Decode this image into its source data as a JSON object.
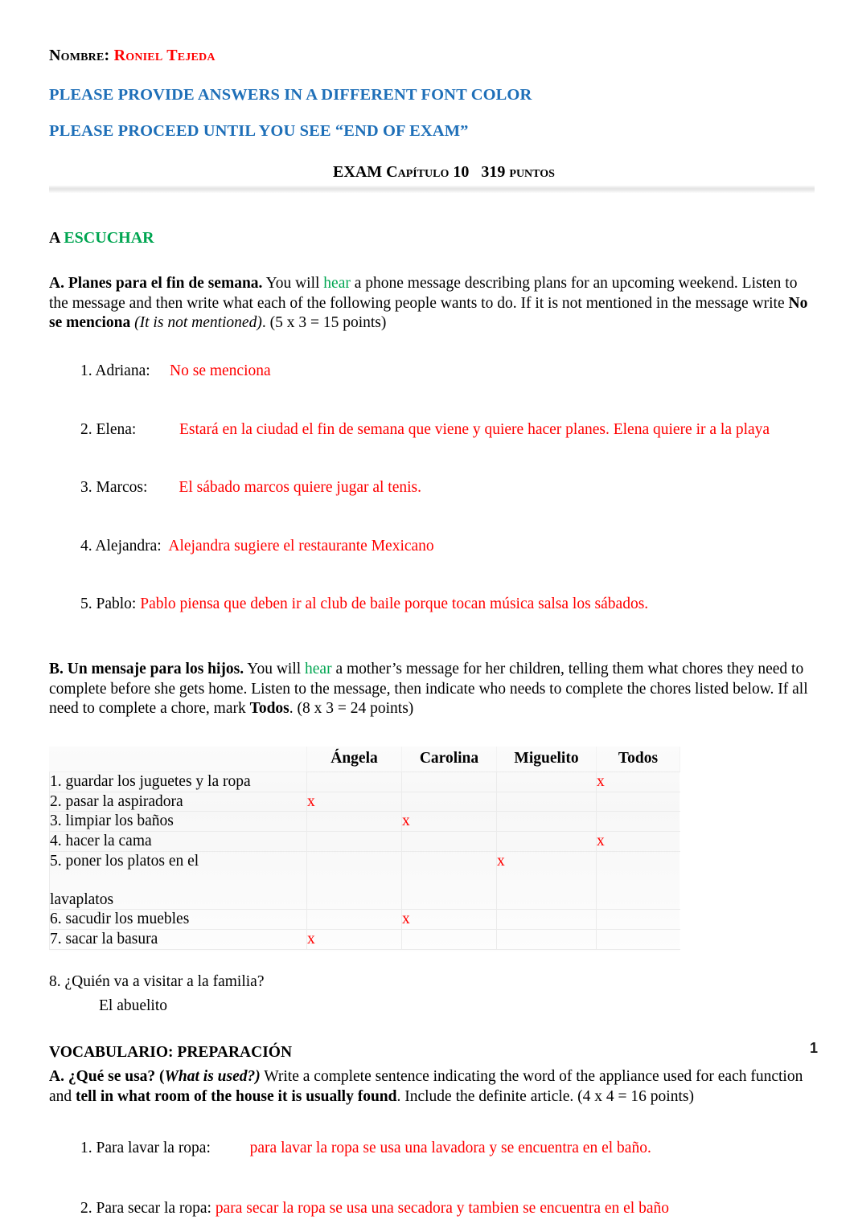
{
  "header": {
    "nombre_label": "Nombre:",
    "student_name": "Roniel Tejeda",
    "notice_1": "PLEASE PROVIDE ANSWERS IN A DIFFERENT FONT COLOR",
    "notice_2": "PLEASE PROCEED UNTIL YOU SEE “END OF EXAM”",
    "exam_title_main": "EXAM ",
    "exam_title_chapter": "Capítulo 10",
    "exam_title_points": "319 puntos"
  },
  "colors": {
    "answer_red": "#FF0000",
    "notice_blue": "#1E6FB8",
    "accent_green": "#00A551",
    "text_black": "#000000",
    "divider_gray": "#E8E8E8",
    "table_border": "#EBEBEB"
  },
  "section_a": {
    "letter": "A ",
    "heading": "ESCUCHAR",
    "activity_a": {
      "title": "A. Planes para el fin de semana.",
      "text_1": "  You will ",
      "link_word": "hear",
      "text_2": " a phone message describing plans for an upcoming weekend. Listen to the message and then write what each of the following people wants to do. If it is not mentioned in the message write ",
      "bold_phrase": "No se menciona",
      "italic_phrase": " (It is not mentioned)",
      "text_3": ".  (5 x 3 = 15 points)",
      "answers": [
        {
          "label": "1. Adriana:",
          "pad": "     ",
          "value": "No se menciona"
        },
        {
          "label": "2. Elena:",
          "pad": "           ",
          "value": "Estará en la ciudad el fin de semana que viene y quiere hacer planes. Elena quiere ir a la playa"
        },
        {
          "label": "3. Marcos:",
          "pad": "        ",
          "value": "El sábado marcos quiere jugar al tenis."
        },
        {
          "label": "4. Alejandra:",
          "pad": "  ",
          "value": "Alejandra sugiere el restaurante Mexicano"
        },
        {
          "label": "5. Pablo:",
          "pad": " ",
          "value": "Pablo piensa que deben ir al club de baile porque tocan música salsa los sábados."
        }
      ]
    },
    "activity_b": {
      "title": "B. Un mensaje para los hijos.",
      "text_1": " You will ",
      "link_word": "hear",
      "text_2": " a mother’s message for her children, telling them what chores they need to complete before she gets home. Listen to the message, then indicate who needs to complete the chores listed below. If all need to complete a chore, mark ",
      "bold_phrase": "Todos",
      "text_3": ". (8 x 3 = 24 points)",
      "table": {
        "columns": [
          "",
          "Ángela",
          "Carolina",
          "Miguelito",
          "Todos"
        ],
        "rows": [
          {
            "chore": "1. guardar los juguetes y la ropa",
            "marks": [
              "",
              "",
              "",
              "x"
            ]
          },
          {
            "chore": "2. pasar la aspiradora",
            "marks": [
              "x",
              "",
              "",
              ""
            ]
          },
          {
            "chore": "3. limpiar los baños",
            "marks": [
              "",
              "x",
              "",
              ""
            ]
          },
          {
            "chore": "4. hacer la cama",
            "marks": [
              "",
              "",
              "",
              "x"
            ]
          },
          {
            "chore": "5. poner los platos en el\n\nlavaplatos",
            "marks": [
              "",
              "",
              "x",
              ""
            ],
            "tall": true
          },
          {
            "chore": "6. sacudir los muebles",
            "marks": [
              "",
              "x",
              "",
              ""
            ]
          },
          {
            "chore": "7. sacar la basura",
            "marks": [
              "x",
              "",
              "",
              ""
            ]
          }
        ]
      },
      "question_8": "8. ¿Quién va a visitar a la familia?",
      "answer_8": "El abuelito"
    }
  },
  "section_vocab": {
    "heading": "VOCABULARIO: PREPARACIÓN",
    "activity_a": {
      "title_bold_1": "A. ¿Qué se usa? (",
      "title_italic": "What is used?)",
      "text_1": " Write a complete sentence indicating the word of the appliance used for each function and ",
      "bold_phrase": "tell in what room of the house it is usually found",
      "text_2": ". Include the definite article.  (4 x 4 = 16 points)",
      "answers": [
        {
          "label": "1. Para lavar la ropa:",
          "pad": "          ",
          "value": "para lavar la ropa se usa una lavadora y se encuentra en el baño."
        },
        {
          "label": "2. Para secar la ropa:",
          "pad": " ",
          "value": "para secar la ropa se usa una secadora y tambien se encuentra en el baño"
        }
      ]
    }
  },
  "footer": {
    "page_number": "1"
  }
}
